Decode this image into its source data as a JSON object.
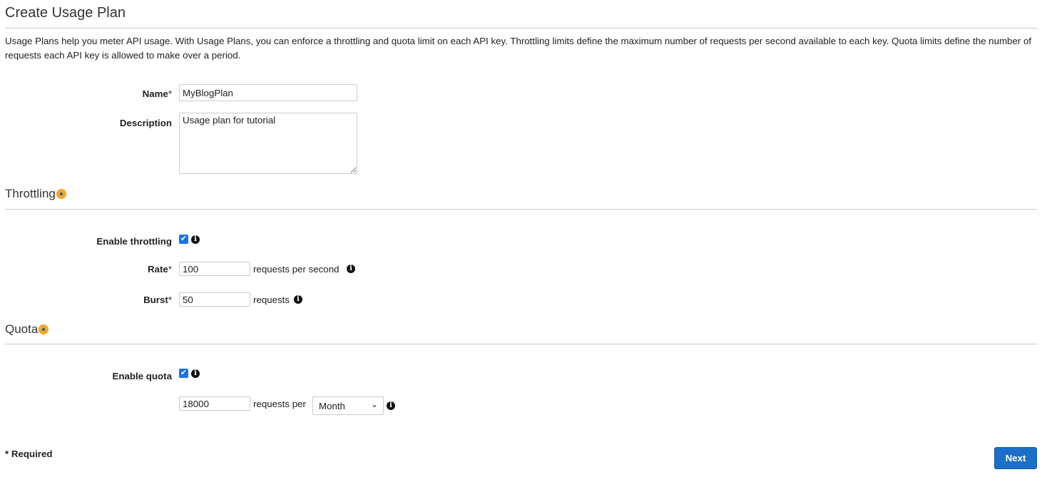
{
  "title": "Create Usage Plan",
  "intro": "Usage Plans help you meter API usage. With Usage Plans, you can enforce a throttling and quota limit on each API key. Throttling limits define the maximum number of requests per second available to each key. Quota limits define the number of requests each API key is allowed to make over a period.",
  "form": {
    "name_label": "Name",
    "name_value": "MyBlogPlan",
    "description_label": "Description",
    "description_value": "Usage plan for tutorial",
    "required_mark": "*"
  },
  "throttling": {
    "heading": "Throttling",
    "enable_label": "Enable throttling",
    "enabled": true,
    "rate_label": "Rate",
    "rate_value": "100",
    "rate_unit": "requests per second",
    "burst_label": "Burst",
    "burst_value": "50",
    "burst_unit": "requests"
  },
  "quota": {
    "heading": "Quota",
    "enable_label": "Enable quota",
    "enabled": true,
    "value": "18000",
    "unit": "requests per",
    "period": "Month"
  },
  "footer": {
    "required_note": "* Required",
    "next_label": "Next"
  },
  "colors": {
    "accent": "#1a6fc9",
    "help_dot": "#f5a623"
  },
  "icons": {
    "help": "help-dot-icon",
    "info": "info-icon",
    "check": "checkbox-icon",
    "chevron": "chevron-down-icon"
  }
}
